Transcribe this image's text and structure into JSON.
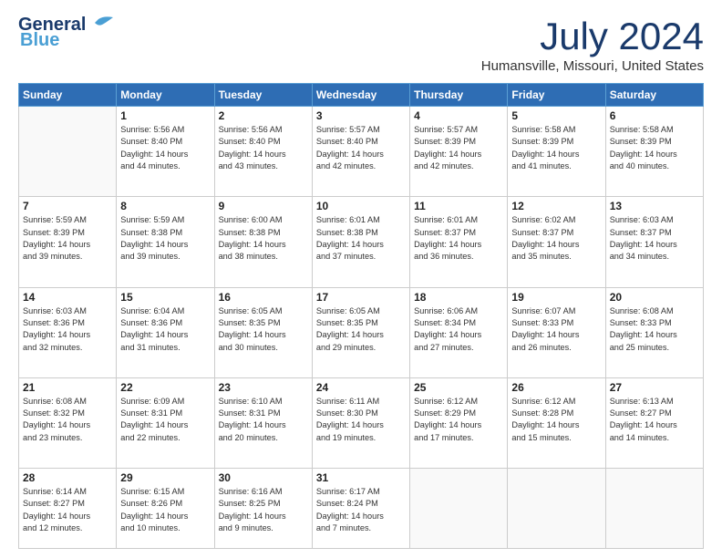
{
  "logo": {
    "line1": "General",
    "line2": "Blue"
  },
  "title": "July 2024",
  "subtitle": "Humansville, Missouri, United States",
  "header_days": [
    "Sunday",
    "Monday",
    "Tuesday",
    "Wednesday",
    "Thursday",
    "Friday",
    "Saturday"
  ],
  "weeks": [
    [
      {
        "day": "",
        "sunrise": "",
        "sunset": "",
        "daylight": ""
      },
      {
        "day": "1",
        "sunrise": "5:56 AM",
        "sunset": "8:40 PM",
        "daylight": "14 hours and 44 minutes."
      },
      {
        "day": "2",
        "sunrise": "5:56 AM",
        "sunset": "8:40 PM",
        "daylight": "14 hours and 43 minutes."
      },
      {
        "day": "3",
        "sunrise": "5:57 AM",
        "sunset": "8:40 PM",
        "daylight": "14 hours and 42 minutes."
      },
      {
        "day": "4",
        "sunrise": "5:57 AM",
        "sunset": "8:39 PM",
        "daylight": "14 hours and 42 minutes."
      },
      {
        "day": "5",
        "sunrise": "5:58 AM",
        "sunset": "8:39 PM",
        "daylight": "14 hours and 41 minutes."
      },
      {
        "day": "6",
        "sunrise": "5:58 AM",
        "sunset": "8:39 PM",
        "daylight": "14 hours and 40 minutes."
      }
    ],
    [
      {
        "day": "7",
        "sunrise": "5:59 AM",
        "sunset": "8:39 PM",
        "daylight": "14 hours and 39 minutes."
      },
      {
        "day": "8",
        "sunrise": "5:59 AM",
        "sunset": "8:38 PM",
        "daylight": "14 hours and 39 minutes."
      },
      {
        "day": "9",
        "sunrise": "6:00 AM",
        "sunset": "8:38 PM",
        "daylight": "14 hours and 38 minutes."
      },
      {
        "day": "10",
        "sunrise": "6:01 AM",
        "sunset": "8:38 PM",
        "daylight": "14 hours and 37 minutes."
      },
      {
        "day": "11",
        "sunrise": "6:01 AM",
        "sunset": "8:37 PM",
        "daylight": "14 hours and 36 minutes."
      },
      {
        "day": "12",
        "sunrise": "6:02 AM",
        "sunset": "8:37 PM",
        "daylight": "14 hours and 35 minutes."
      },
      {
        "day": "13",
        "sunrise": "6:03 AM",
        "sunset": "8:37 PM",
        "daylight": "14 hours and 34 minutes."
      }
    ],
    [
      {
        "day": "14",
        "sunrise": "6:03 AM",
        "sunset": "8:36 PM",
        "daylight": "14 hours and 32 minutes."
      },
      {
        "day": "15",
        "sunrise": "6:04 AM",
        "sunset": "8:36 PM",
        "daylight": "14 hours and 31 minutes."
      },
      {
        "day": "16",
        "sunrise": "6:05 AM",
        "sunset": "8:35 PM",
        "daylight": "14 hours and 30 minutes."
      },
      {
        "day": "17",
        "sunrise": "6:05 AM",
        "sunset": "8:35 PM",
        "daylight": "14 hours and 29 minutes."
      },
      {
        "day": "18",
        "sunrise": "6:06 AM",
        "sunset": "8:34 PM",
        "daylight": "14 hours and 27 minutes."
      },
      {
        "day": "19",
        "sunrise": "6:07 AM",
        "sunset": "8:33 PM",
        "daylight": "14 hours and 26 minutes."
      },
      {
        "day": "20",
        "sunrise": "6:08 AM",
        "sunset": "8:33 PM",
        "daylight": "14 hours and 25 minutes."
      }
    ],
    [
      {
        "day": "21",
        "sunrise": "6:08 AM",
        "sunset": "8:32 PM",
        "daylight": "14 hours and 23 minutes."
      },
      {
        "day": "22",
        "sunrise": "6:09 AM",
        "sunset": "8:31 PM",
        "daylight": "14 hours and 22 minutes."
      },
      {
        "day": "23",
        "sunrise": "6:10 AM",
        "sunset": "8:31 PM",
        "daylight": "14 hours and 20 minutes."
      },
      {
        "day": "24",
        "sunrise": "6:11 AM",
        "sunset": "8:30 PM",
        "daylight": "14 hours and 19 minutes."
      },
      {
        "day": "25",
        "sunrise": "6:12 AM",
        "sunset": "8:29 PM",
        "daylight": "14 hours and 17 minutes."
      },
      {
        "day": "26",
        "sunrise": "6:12 AM",
        "sunset": "8:28 PM",
        "daylight": "14 hours and 15 minutes."
      },
      {
        "day": "27",
        "sunrise": "6:13 AM",
        "sunset": "8:27 PM",
        "daylight": "14 hours and 14 minutes."
      }
    ],
    [
      {
        "day": "28",
        "sunrise": "6:14 AM",
        "sunset": "8:27 PM",
        "daylight": "14 hours and 12 minutes."
      },
      {
        "day": "29",
        "sunrise": "6:15 AM",
        "sunset": "8:26 PM",
        "daylight": "14 hours and 10 minutes."
      },
      {
        "day": "30",
        "sunrise": "6:16 AM",
        "sunset": "8:25 PM",
        "daylight": "14 hours and 9 minutes."
      },
      {
        "day": "31",
        "sunrise": "6:17 AM",
        "sunset": "8:24 PM",
        "daylight": "14 hours and 7 minutes."
      },
      {
        "day": "",
        "sunrise": "",
        "sunset": "",
        "daylight": ""
      },
      {
        "day": "",
        "sunrise": "",
        "sunset": "",
        "daylight": ""
      },
      {
        "day": "",
        "sunrise": "",
        "sunset": "",
        "daylight": ""
      }
    ]
  ]
}
